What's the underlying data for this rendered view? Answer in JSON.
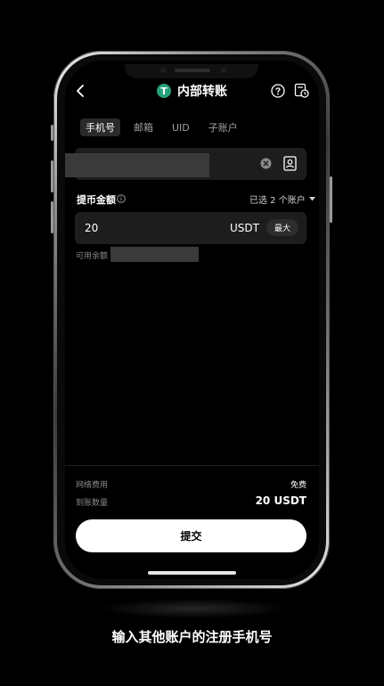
{
  "header": {
    "title": "内部转账",
    "coin_icon_glyph": "T",
    "coin_icon_color": "#26a17b"
  },
  "tabs": [
    {
      "label": "手机号",
      "active": true
    },
    {
      "label": "邮箱",
      "active": false
    },
    {
      "label": "UID",
      "active": false
    },
    {
      "label": "子账户",
      "active": false
    }
  ],
  "phone_input": {
    "value": "",
    "redacted": true
  },
  "amount": {
    "label": "提币金额",
    "account_selector": "已选 2 个账户",
    "value": "20",
    "unit": "USDT",
    "max_label": "最大",
    "available_label": "可用余额"
  },
  "summary": {
    "fee_label": "网络费用",
    "fee_value": "免费",
    "received_label": "到账数量",
    "received_value": "20 USDT"
  },
  "submit_label": "提交",
  "caption": "输入其他账户的注册手机号",
  "icons": [
    "back-icon",
    "help-icon",
    "history-icon",
    "clear-icon",
    "contacts-icon",
    "info-icon",
    "caret-down-icon"
  ]
}
